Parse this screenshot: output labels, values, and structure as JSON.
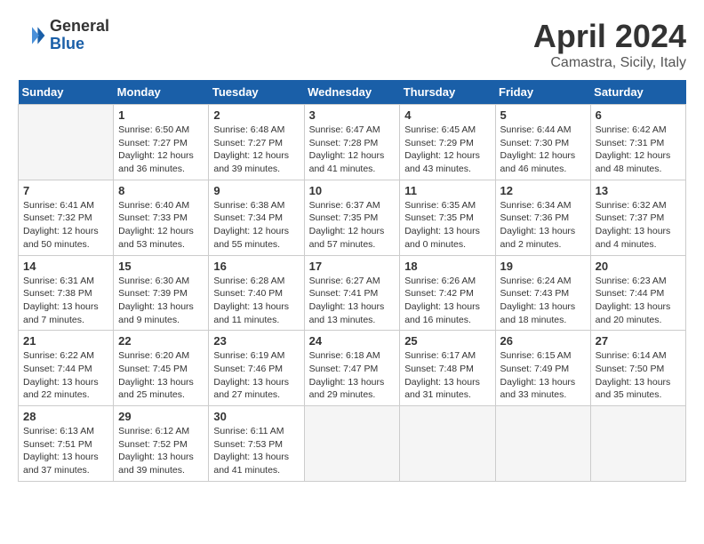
{
  "header": {
    "logo_line1": "General",
    "logo_line2": "Blue",
    "month": "April 2024",
    "location": "Camastra, Sicily, Italy"
  },
  "days_of_week": [
    "Sunday",
    "Monday",
    "Tuesday",
    "Wednesday",
    "Thursday",
    "Friday",
    "Saturday"
  ],
  "weeks": [
    [
      {
        "day": "",
        "empty": true
      },
      {
        "day": "1",
        "sunrise": "Sunrise: 6:50 AM",
        "sunset": "Sunset: 7:27 PM",
        "daylight": "Daylight: 12 hours and 36 minutes."
      },
      {
        "day": "2",
        "sunrise": "Sunrise: 6:48 AM",
        "sunset": "Sunset: 7:27 PM",
        "daylight": "Daylight: 12 hours and 39 minutes."
      },
      {
        "day": "3",
        "sunrise": "Sunrise: 6:47 AM",
        "sunset": "Sunset: 7:28 PM",
        "daylight": "Daylight: 12 hours and 41 minutes."
      },
      {
        "day": "4",
        "sunrise": "Sunrise: 6:45 AM",
        "sunset": "Sunset: 7:29 PM",
        "daylight": "Daylight: 12 hours and 43 minutes."
      },
      {
        "day": "5",
        "sunrise": "Sunrise: 6:44 AM",
        "sunset": "Sunset: 7:30 PM",
        "daylight": "Daylight: 12 hours and 46 minutes."
      },
      {
        "day": "6",
        "sunrise": "Sunrise: 6:42 AM",
        "sunset": "Sunset: 7:31 PM",
        "daylight": "Daylight: 12 hours and 48 minutes."
      }
    ],
    [
      {
        "day": "7",
        "sunrise": "Sunrise: 6:41 AM",
        "sunset": "Sunset: 7:32 PM",
        "daylight": "Daylight: 12 hours and 50 minutes."
      },
      {
        "day": "8",
        "sunrise": "Sunrise: 6:40 AM",
        "sunset": "Sunset: 7:33 PM",
        "daylight": "Daylight: 12 hours and 53 minutes."
      },
      {
        "day": "9",
        "sunrise": "Sunrise: 6:38 AM",
        "sunset": "Sunset: 7:34 PM",
        "daylight": "Daylight: 12 hours and 55 minutes."
      },
      {
        "day": "10",
        "sunrise": "Sunrise: 6:37 AM",
        "sunset": "Sunset: 7:35 PM",
        "daylight": "Daylight: 12 hours and 57 minutes."
      },
      {
        "day": "11",
        "sunrise": "Sunrise: 6:35 AM",
        "sunset": "Sunset: 7:35 PM",
        "daylight": "Daylight: 13 hours and 0 minutes."
      },
      {
        "day": "12",
        "sunrise": "Sunrise: 6:34 AM",
        "sunset": "Sunset: 7:36 PM",
        "daylight": "Daylight: 13 hours and 2 minutes."
      },
      {
        "day": "13",
        "sunrise": "Sunrise: 6:32 AM",
        "sunset": "Sunset: 7:37 PM",
        "daylight": "Daylight: 13 hours and 4 minutes."
      }
    ],
    [
      {
        "day": "14",
        "sunrise": "Sunrise: 6:31 AM",
        "sunset": "Sunset: 7:38 PM",
        "daylight": "Daylight: 13 hours and 7 minutes."
      },
      {
        "day": "15",
        "sunrise": "Sunrise: 6:30 AM",
        "sunset": "Sunset: 7:39 PM",
        "daylight": "Daylight: 13 hours and 9 minutes."
      },
      {
        "day": "16",
        "sunrise": "Sunrise: 6:28 AM",
        "sunset": "Sunset: 7:40 PM",
        "daylight": "Daylight: 13 hours and 11 minutes."
      },
      {
        "day": "17",
        "sunrise": "Sunrise: 6:27 AM",
        "sunset": "Sunset: 7:41 PM",
        "daylight": "Daylight: 13 hours and 13 minutes."
      },
      {
        "day": "18",
        "sunrise": "Sunrise: 6:26 AM",
        "sunset": "Sunset: 7:42 PM",
        "daylight": "Daylight: 13 hours and 16 minutes."
      },
      {
        "day": "19",
        "sunrise": "Sunrise: 6:24 AM",
        "sunset": "Sunset: 7:43 PM",
        "daylight": "Daylight: 13 hours and 18 minutes."
      },
      {
        "day": "20",
        "sunrise": "Sunrise: 6:23 AM",
        "sunset": "Sunset: 7:44 PM",
        "daylight": "Daylight: 13 hours and 20 minutes."
      }
    ],
    [
      {
        "day": "21",
        "sunrise": "Sunrise: 6:22 AM",
        "sunset": "Sunset: 7:44 PM",
        "daylight": "Daylight: 13 hours and 22 minutes."
      },
      {
        "day": "22",
        "sunrise": "Sunrise: 6:20 AM",
        "sunset": "Sunset: 7:45 PM",
        "daylight": "Daylight: 13 hours and 25 minutes."
      },
      {
        "day": "23",
        "sunrise": "Sunrise: 6:19 AM",
        "sunset": "Sunset: 7:46 PM",
        "daylight": "Daylight: 13 hours and 27 minutes."
      },
      {
        "day": "24",
        "sunrise": "Sunrise: 6:18 AM",
        "sunset": "Sunset: 7:47 PM",
        "daylight": "Daylight: 13 hours and 29 minutes."
      },
      {
        "day": "25",
        "sunrise": "Sunrise: 6:17 AM",
        "sunset": "Sunset: 7:48 PM",
        "daylight": "Daylight: 13 hours and 31 minutes."
      },
      {
        "day": "26",
        "sunrise": "Sunrise: 6:15 AM",
        "sunset": "Sunset: 7:49 PM",
        "daylight": "Daylight: 13 hours and 33 minutes."
      },
      {
        "day": "27",
        "sunrise": "Sunrise: 6:14 AM",
        "sunset": "Sunset: 7:50 PM",
        "daylight": "Daylight: 13 hours and 35 minutes."
      }
    ],
    [
      {
        "day": "28",
        "sunrise": "Sunrise: 6:13 AM",
        "sunset": "Sunset: 7:51 PM",
        "daylight": "Daylight: 13 hours and 37 minutes."
      },
      {
        "day": "29",
        "sunrise": "Sunrise: 6:12 AM",
        "sunset": "Sunset: 7:52 PM",
        "daylight": "Daylight: 13 hours and 39 minutes."
      },
      {
        "day": "30",
        "sunrise": "Sunrise: 6:11 AM",
        "sunset": "Sunset: 7:53 PM",
        "daylight": "Daylight: 13 hours and 41 minutes."
      },
      {
        "day": "",
        "empty": true
      },
      {
        "day": "",
        "empty": true
      },
      {
        "day": "",
        "empty": true
      },
      {
        "day": "",
        "empty": true
      }
    ]
  ]
}
